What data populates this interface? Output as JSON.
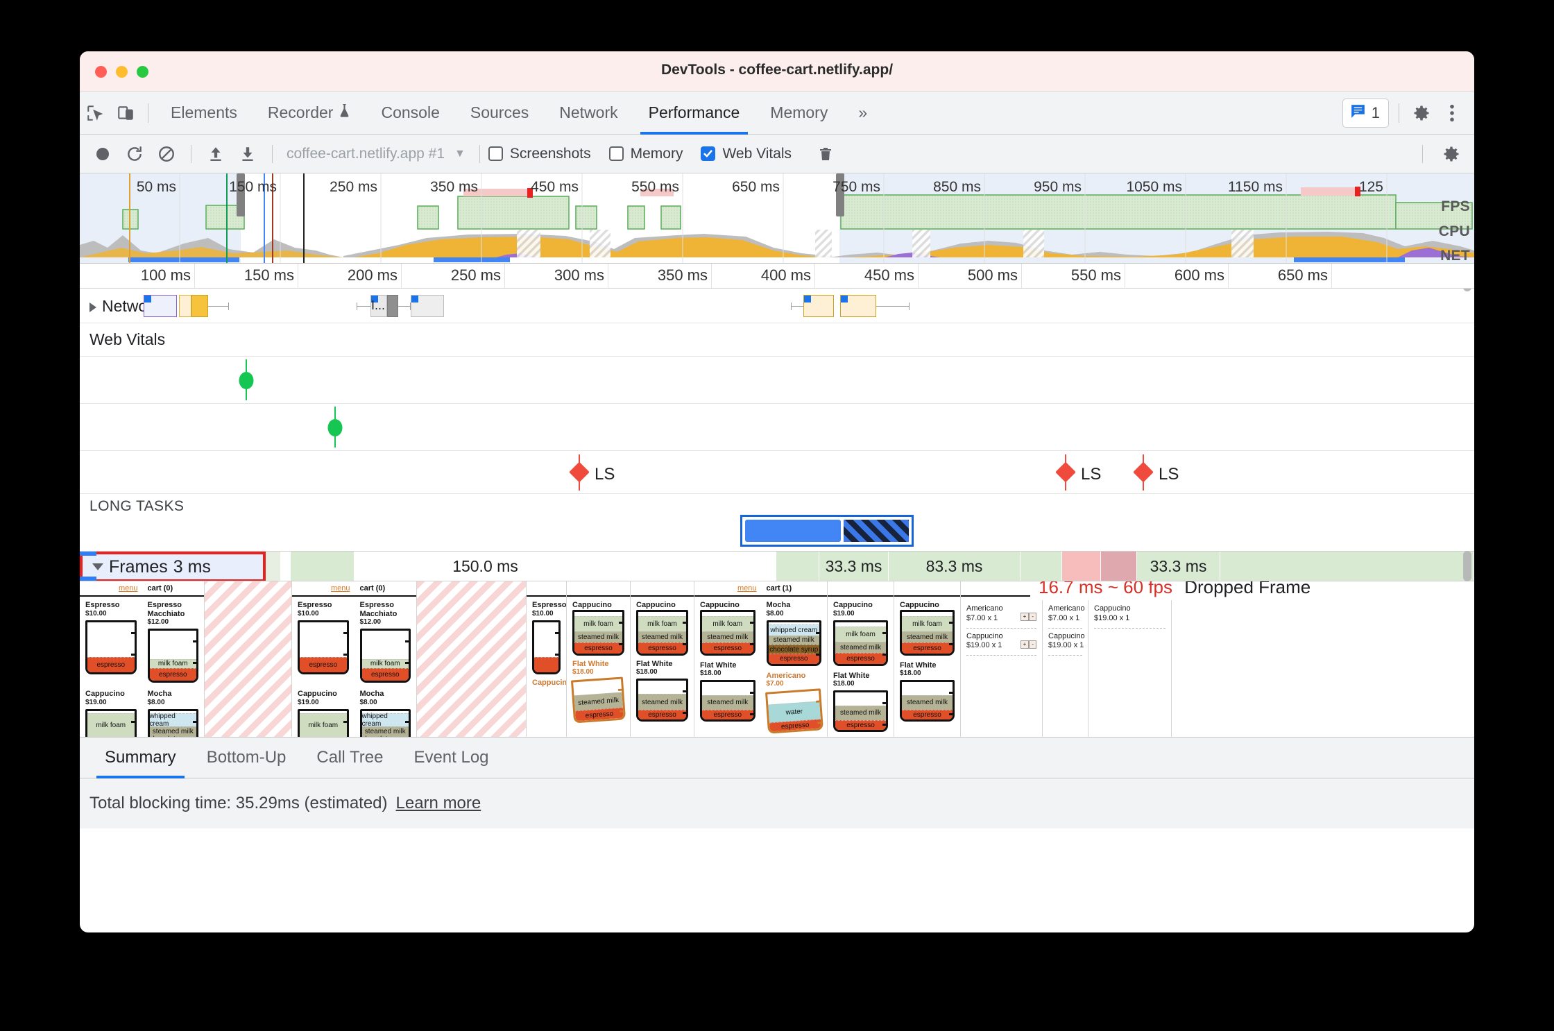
{
  "window": {
    "title": "DevTools - coffee-cart.netlify.app/"
  },
  "tabstrip": {
    "inspect_icon": "inspect-cursor-icon",
    "device_icon": "device-toolbar-icon",
    "tabs": [
      {
        "label": "Elements",
        "active": false
      },
      {
        "label": "Recorder",
        "active": false,
        "badge": "flask-icon"
      },
      {
        "label": "Console",
        "active": false
      },
      {
        "label": "Sources",
        "active": false
      },
      {
        "label": "Network",
        "active": false
      },
      {
        "label": "Performance",
        "active": true
      },
      {
        "label": "Memory",
        "active": false
      }
    ],
    "more_tabs_label": "»",
    "issues_count": "1",
    "settings_icon": "gear-icon",
    "more_options_icon": "kebab-menu-icon"
  },
  "rec_toolbar": {
    "record_icon": "record-circle-icon",
    "reload_icon": "reload-record-icon",
    "clear_icon": "clear-prohibited-icon",
    "load_icon": "load-profile-up-arrow-icon",
    "save_icon": "save-profile-down-arrow-icon",
    "profile_label": "coffee-cart.netlify.app #1",
    "profile_caret": "▼",
    "checkboxes": [
      {
        "label": "Screenshots",
        "checked": false
      },
      {
        "label": "Memory",
        "checked": false
      },
      {
        "label": "Web Vitals",
        "checked": true
      }
    ],
    "trash_icon": "trash-icon",
    "capture_settings_icon": "gear-icon"
  },
  "overview": {
    "ticks": [
      "50 ms",
      "150 ms",
      "250 ms",
      "350 ms",
      "450 ms",
      "550 ms",
      "650 ms",
      "750 ms",
      "850 ms",
      "950 ms",
      "1050 ms",
      "1150 ms",
      "125"
    ],
    "band_labels": [
      "FPS",
      "CPU",
      "NET"
    ]
  },
  "detail_ruler": {
    "ticks": [
      "100 ms",
      "150 ms",
      "200 ms",
      "250 ms",
      "300 ms",
      "350 ms",
      "400 ms",
      "450 ms",
      "500 ms",
      "550 ms",
      "600 ms",
      "650 ms"
    ]
  },
  "tracks": {
    "network_label": "Network",
    "network_group_expander": "▶",
    "request_short_label": "I...",
    "web_vitals_label": "Web Vitals",
    "long_tasks_label": "LONG TASKS",
    "markers": [
      {
        "type": "good-dot",
        "label": ""
      },
      {
        "type": "good-dot",
        "label": ""
      },
      {
        "type": "poor-diamond",
        "label": "LS"
      },
      {
        "type": "poor-diamond",
        "label": "LS"
      },
      {
        "type": "poor-diamond",
        "label": "LS"
      }
    ]
  },
  "frames": {
    "header_label": "Frames",
    "header_expander": "▼",
    "durations": [
      "3 ms",
      "150.0 ms",
      "33.3 ms",
      "83.3 ms",
      "33.3 ms"
    ],
    "tooltip_duration": "16.7 ms ~ 60 fps",
    "tooltip_status": "Dropped Frame"
  },
  "filmstrip": {
    "menu_label": "menu",
    "cart_labels": [
      "cart (0)",
      "cart (1)"
    ],
    "products": [
      {
        "name": "Espresso",
        "price": "$10.00",
        "layers": [
          "espresso"
        ]
      },
      {
        "name": "Espresso Macchiato",
        "price": "$12.00",
        "layers": [
          "milk foam",
          "espresso"
        ]
      },
      {
        "name": "Cappucino",
        "price": "$19.00",
        "layers": [
          "milk foam",
          "steamed milk",
          "espresso"
        ]
      },
      {
        "name": "Mocha",
        "price": "$8.00",
        "layers": [
          "whipped cream",
          "steamed milk",
          "chocolate syrup",
          "espresso"
        ]
      },
      {
        "name": "Flat White",
        "price": "$18.00",
        "layers": [
          "steamed milk",
          "espresso"
        ]
      },
      {
        "name": "Americano",
        "price": "$7.00",
        "layers": [
          "water",
          "espresso"
        ]
      }
    ],
    "cart_items": [
      {
        "name": "Americano",
        "detail": "$7.00 x 1"
      },
      {
        "name": "Cappucino",
        "detail": "$19.00 x 1"
      }
    ],
    "cart_qty_plus": "+",
    "cart_qty_minus": "-"
  },
  "bottom": {
    "tabs": [
      {
        "label": "Summary",
        "active": true
      },
      {
        "label": "Bottom-Up",
        "active": false
      },
      {
        "label": "Call Tree",
        "active": false
      },
      {
        "label": "Event Log",
        "active": false
      }
    ],
    "status_text": "Total blocking time: 35.29ms (estimated)",
    "status_link": "Learn more"
  },
  "colors": {
    "accent": "#1a73e8",
    "good": "#16c653",
    "poor": "#f04a3c",
    "highlight_border": "#e8221f",
    "frame_good": "#d9ead3",
    "frame_dropped": "#f7bcbc"
  }
}
